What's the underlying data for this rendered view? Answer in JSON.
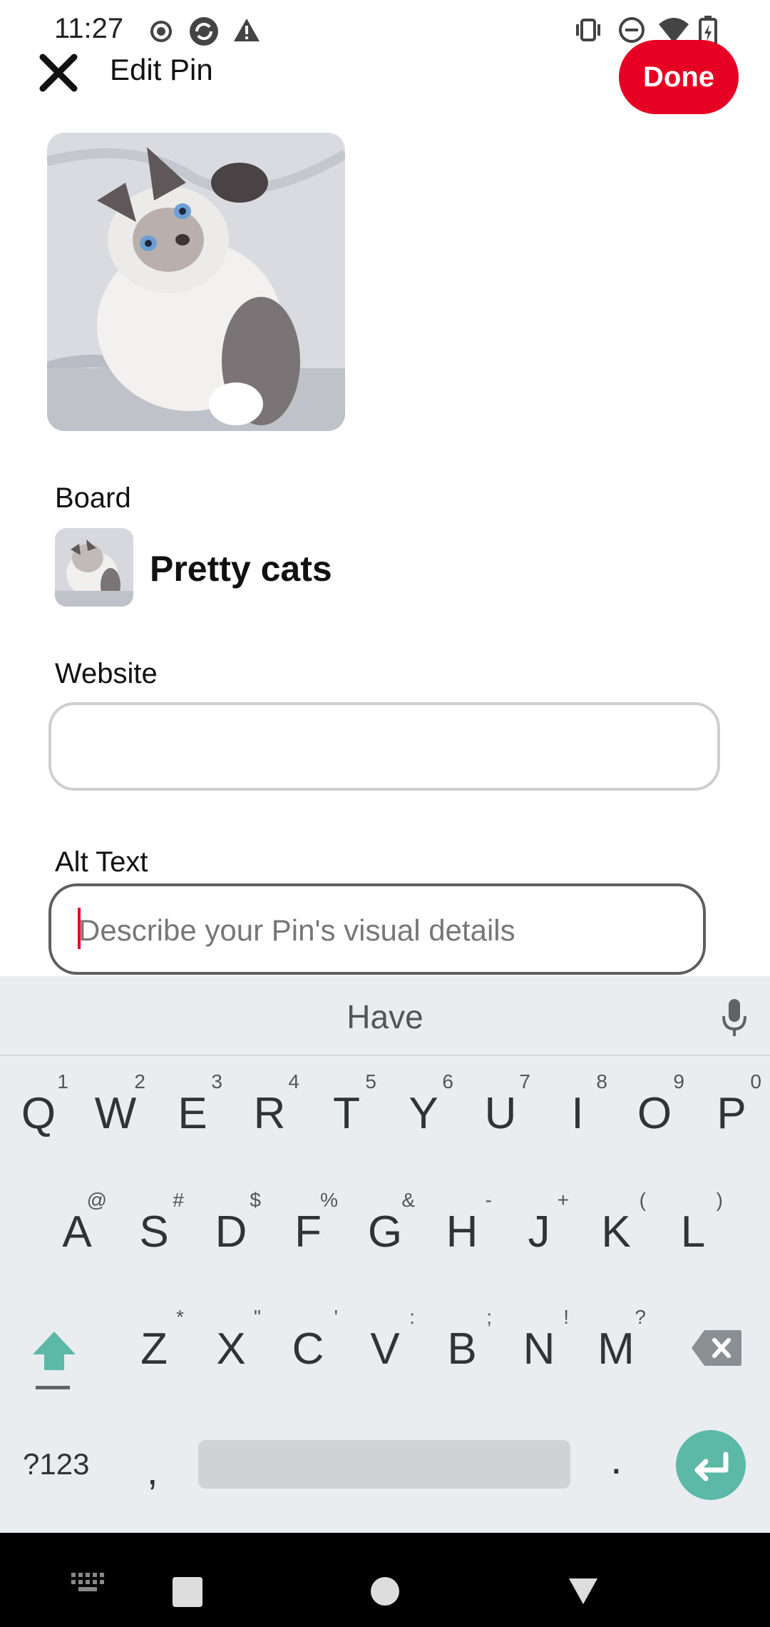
{
  "status_bar": {
    "time": "11:27",
    "icons": [
      "record-icon",
      "sync-icon",
      "alert-icon",
      "vibrate-icon",
      "dnd-icon",
      "wifi-icon",
      "battery-charging-icon"
    ]
  },
  "header": {
    "title": "Edit Pin",
    "done_label": "Done",
    "close_icon": "close-icon",
    "accent_color": "#e60023"
  },
  "pin": {
    "image": "cat-photo"
  },
  "board": {
    "label": "Board",
    "name": "Pretty cats"
  },
  "website": {
    "label": "Website",
    "value": ""
  },
  "alt_text": {
    "label": "Alt Text",
    "placeholder": "Describe your Pin's visual details"
  },
  "keyboard": {
    "suggestion": "Have",
    "row1": [
      {
        "k": "Q",
        "s": "1"
      },
      {
        "k": "W",
        "s": "2"
      },
      {
        "k": "E",
        "s": "3"
      },
      {
        "k": "R",
        "s": "4"
      },
      {
        "k": "T",
        "s": "5"
      },
      {
        "k": "Y",
        "s": "6"
      },
      {
        "k": "U",
        "s": "7"
      },
      {
        "k": "I",
        "s": "8"
      },
      {
        "k": "O",
        "s": "9"
      },
      {
        "k": "P",
        "s": "0"
      }
    ],
    "row2": [
      {
        "k": "A",
        "s": "@"
      },
      {
        "k": "S",
        "s": "#"
      },
      {
        "k": "D",
        "s": "$"
      },
      {
        "k": "F",
        "s": "%"
      },
      {
        "k": "G",
        "s": "&"
      },
      {
        "k": "H",
        "s": "-"
      },
      {
        "k": "J",
        "s": "+"
      },
      {
        "k": "K",
        "s": "("
      },
      {
        "k": "L",
        "s": ")"
      }
    ],
    "row3": [
      {
        "k": "Z",
        "s": "*"
      },
      {
        "k": "X",
        "s": "\""
      },
      {
        "k": "C",
        "s": "'"
      },
      {
        "k": "V",
        "s": ":"
      },
      {
        "k": "B",
        "s": ";"
      },
      {
        "k": "N",
        "s": "!"
      },
      {
        "k": "M",
        "s": "?"
      }
    ],
    "symbols_label": "?123",
    "comma": ",",
    "period": ".",
    "enter_color": "#5cb8a7"
  },
  "nav_bar": {
    "icons": [
      "keyboard-icon",
      "recents-icon",
      "home-icon",
      "back-icon"
    ]
  }
}
